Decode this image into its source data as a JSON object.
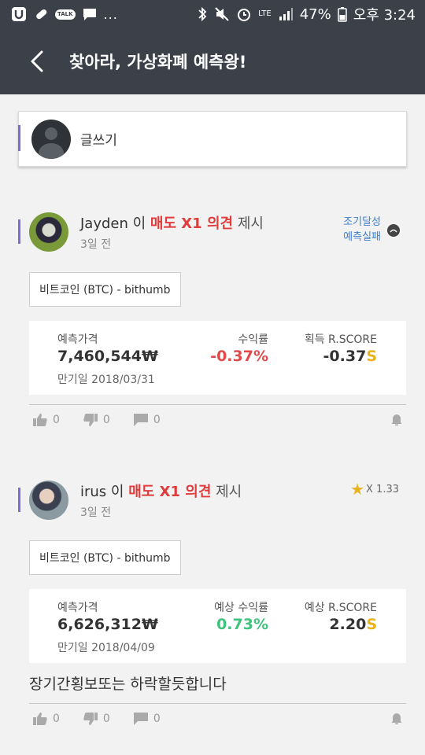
{
  "status_bar": {
    "talk_label": "TALK",
    "more": "...",
    "network": "LTE",
    "battery": "47%",
    "time": "오후 3:24"
  },
  "app_bar": {
    "title": "찾아라, 가상화폐 예측왕!"
  },
  "compose": {
    "label": "글쓰기"
  },
  "posts": [
    {
      "author": "Jayden",
      "particle": " 이 ",
      "opinion": "매도 X1 의견",
      "suffix": " 제시",
      "time": "3일 전",
      "badges": [
        "조기달성",
        "예측실패"
      ],
      "coin": "비트코인 (BTC) - bithumb",
      "price_label": "예측가격",
      "price": "7,460,544₩",
      "expiry": "만기일 2018/03/31",
      "return_label": "수익률",
      "return_value": "-0.37%",
      "return_color": "#e04a4a",
      "score_label": "획득 R.SCORE",
      "score_value": "-0.37",
      "score_unit": "S",
      "likes": "0",
      "dislikes": "0",
      "comments": "0"
    },
    {
      "author": "irus",
      "particle": " 이 ",
      "opinion": "매도 X1 의견",
      "suffix": " 제시",
      "time": "3일 전",
      "multiplier": "X 1.33",
      "coin": "비트코인 (BTC) - bithumb",
      "price_label": "예측가격",
      "price": "6,626,312₩",
      "expiry": "만기일 2018/04/09",
      "return_label": "예상 수익률",
      "return_value": "0.73%",
      "return_color": "#3cc47c",
      "score_label": "예상 R.SCORE",
      "score_value": "2.20",
      "score_unit": "S",
      "body": "장기간횡보또는 하락할듯합니다",
      "likes": "0",
      "dislikes": "0",
      "comments": "0"
    }
  ]
}
